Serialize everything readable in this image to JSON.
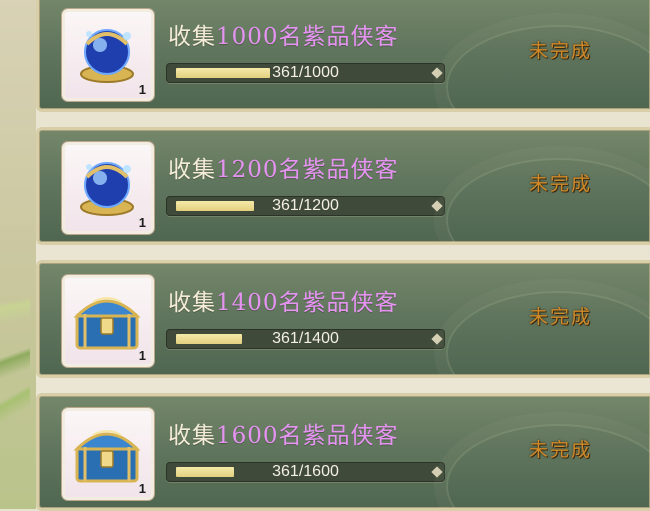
{
  "tasks": [
    {
      "title_prefix": "收集",
      "title_highlight": "1000名紫品侠客",
      "progress_text": "361/1000",
      "progress": 0.361,
      "status": "未完成",
      "item_icon": "blue-orb-icon",
      "item_qty": "1"
    },
    {
      "title_prefix": "收集",
      "title_highlight": "1200名紫品侠客",
      "progress_text": "361/1200",
      "progress": 0.3008,
      "status": "未完成",
      "item_icon": "blue-orb-icon",
      "item_qty": "1"
    },
    {
      "title_prefix": "收集",
      "title_highlight": "1400名紫品侠客",
      "progress_text": "361/1400",
      "progress": 0.2579,
      "status": "未完成",
      "item_icon": "treasure-chest-icon",
      "item_qty": "1"
    },
    {
      "title_prefix": "收集",
      "title_highlight": "1600名紫品侠客",
      "progress_text": "361/1600",
      "progress": 0.2256,
      "status": "未完成",
      "item_icon": "treasure-chest-icon",
      "item_qty": "1"
    }
  ],
  "colors": {
    "highlight": "#e493f1",
    "status": "#cf8a2a",
    "bar_fill": "#e3d07f"
  }
}
